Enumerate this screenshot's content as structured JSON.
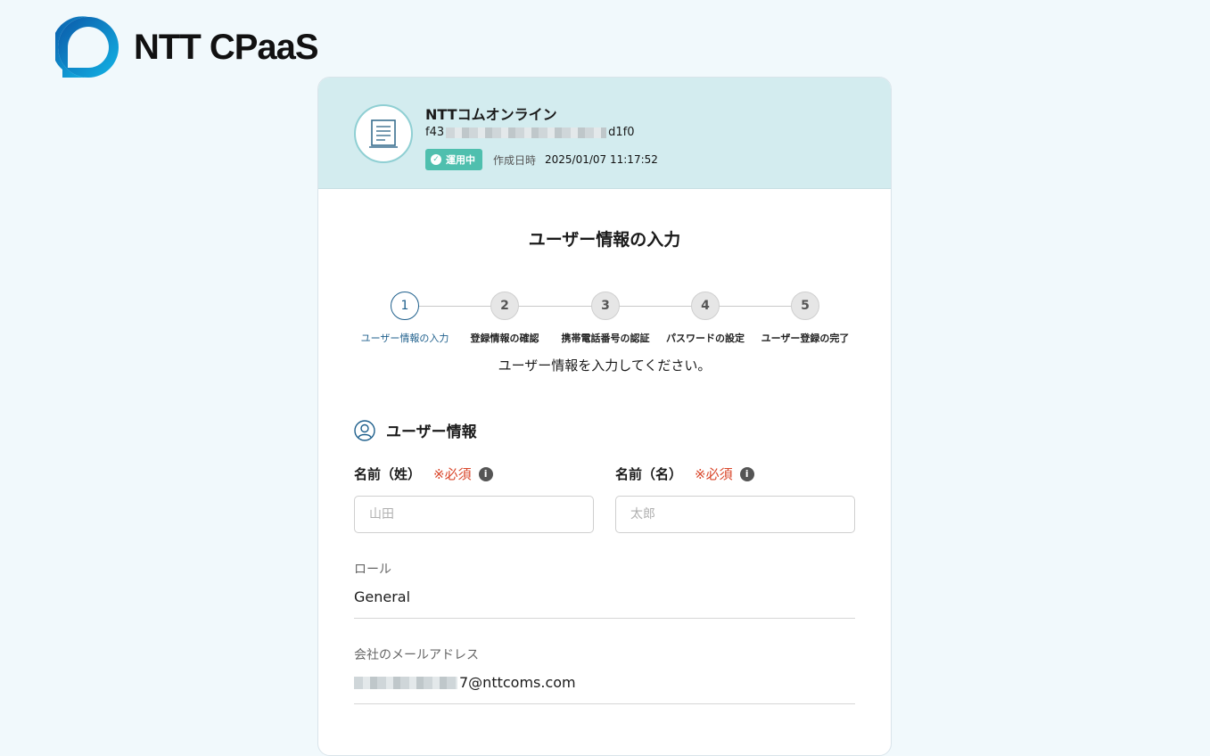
{
  "brand": {
    "name": "NTT CPaaS"
  },
  "org": {
    "name": "NTTコムオンライン",
    "id_prefix": "f43",
    "id_suffix": "d1f0",
    "status": "運用中",
    "created_label": "作成日時",
    "created_value": "2025/01/07 11:17:52"
  },
  "page": {
    "title": "ユーザー情報の入力",
    "instruction": "ユーザー情報を入力してください。"
  },
  "steps": [
    {
      "num": "1",
      "label": "ユーザー情報の入力"
    },
    {
      "num": "2",
      "label": "登録情報の確認"
    },
    {
      "num": "3",
      "label": "携帯電話番号の認証"
    },
    {
      "num": "4",
      "label": "パスワードの設定"
    },
    {
      "num": "5",
      "label": "ユーザー登録の完了"
    }
  ],
  "section": {
    "title": "ユーザー情報"
  },
  "fields": {
    "last_name": {
      "label": "名前（姓）",
      "required": "※必須",
      "placeholder": "山田",
      "value": ""
    },
    "first_name": {
      "label": "名前（名）",
      "required": "※必須",
      "placeholder": "太郎",
      "value": ""
    }
  },
  "role": {
    "label": "ロール",
    "value": "General"
  },
  "email": {
    "label": "会社のメールアドレス",
    "value_suffix": "7@nttcoms.com"
  },
  "colors": {
    "accent": "#1e5f8c",
    "header_bg": "#d3ecef",
    "badge": "#4fbfae",
    "required": "#d9472b"
  }
}
